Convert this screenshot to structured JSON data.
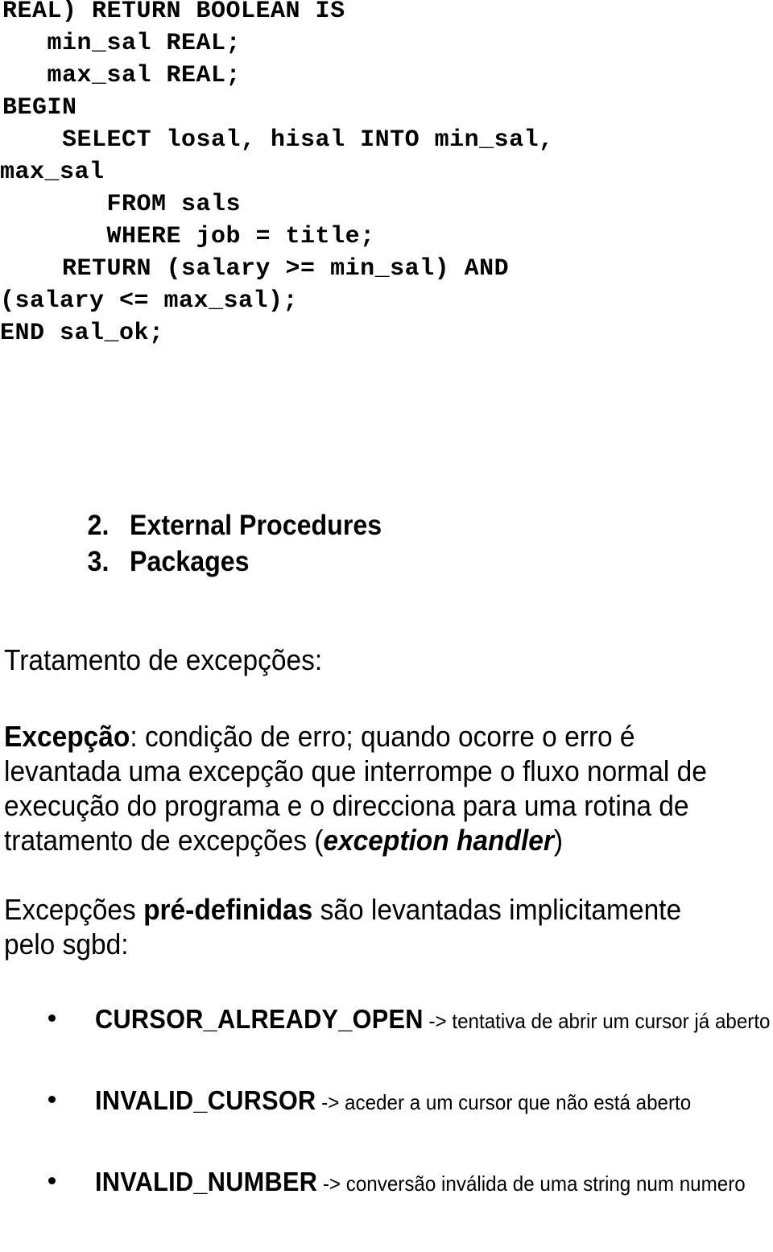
{
  "document": {
    "language": "pt-PT",
    "code_block": {
      "name": "plsql-function-sal-ok",
      "lines": [
        {
          "text": "REAL) RETURN BOOLEAN IS",
          "wrapped": false
        },
        {
          "text": "   min_sal REAL;",
          "wrapped": false
        },
        {
          "text": "   max_sal REAL;",
          "wrapped": false
        },
        {
          "text": "BEGIN",
          "wrapped": false
        },
        {
          "text": "    SELECT losal, hisal INTO min_sal,",
          "wrapped": false
        },
        {
          "text": "max_sal",
          "wrapped": true
        },
        {
          "text": "       FROM sals",
          "wrapped": false
        },
        {
          "text": "       WHERE job = title;",
          "wrapped": false
        },
        {
          "text": "    RETURN (salary >= min_sal) AND",
          "wrapped": false
        },
        {
          "text": "(salary <= max_sal);",
          "wrapped": true
        },
        {
          "text": "END sal_ok;",
          "wrapped": true
        }
      ]
    },
    "agenda_list": {
      "items": [
        {
          "marker": "2.",
          "label": "External Procedures"
        },
        {
          "marker": "3.",
          "label": "Packages"
        }
      ]
    },
    "section_heading": "Tratamento de excepções:",
    "exception_definition": {
      "lead": "Excepção",
      "body_before": ": condição de erro; quando ocorre o erro é levantada uma excepção que interrompe o fluxo normal de execução do programa e o direcciona para uma rotina de tratamento de excepções (",
      "emphasis": "exception handler",
      "body_after": ")"
    },
    "predefined_intro": {
      "before": "Excepções ",
      "bold": "pré-definidas",
      "after": " são levantadas implicitamente pelo sgbd:"
    },
    "predefined_exceptions": [
      {
        "name": "CURSOR_ALREADY_OPEN",
        "description": "-> tentativa de abrir um cursor já aberto"
      },
      {
        "name": "INVALID_CURSOR",
        "description": "-> aceder a um cursor que não está aberto"
      },
      {
        "name": "INVALID_NUMBER",
        "description": "-> conversão inválida de uma string num numero"
      }
    ]
  },
  "colors": {
    "text": "#000000",
    "background": "#ffffff"
  }
}
